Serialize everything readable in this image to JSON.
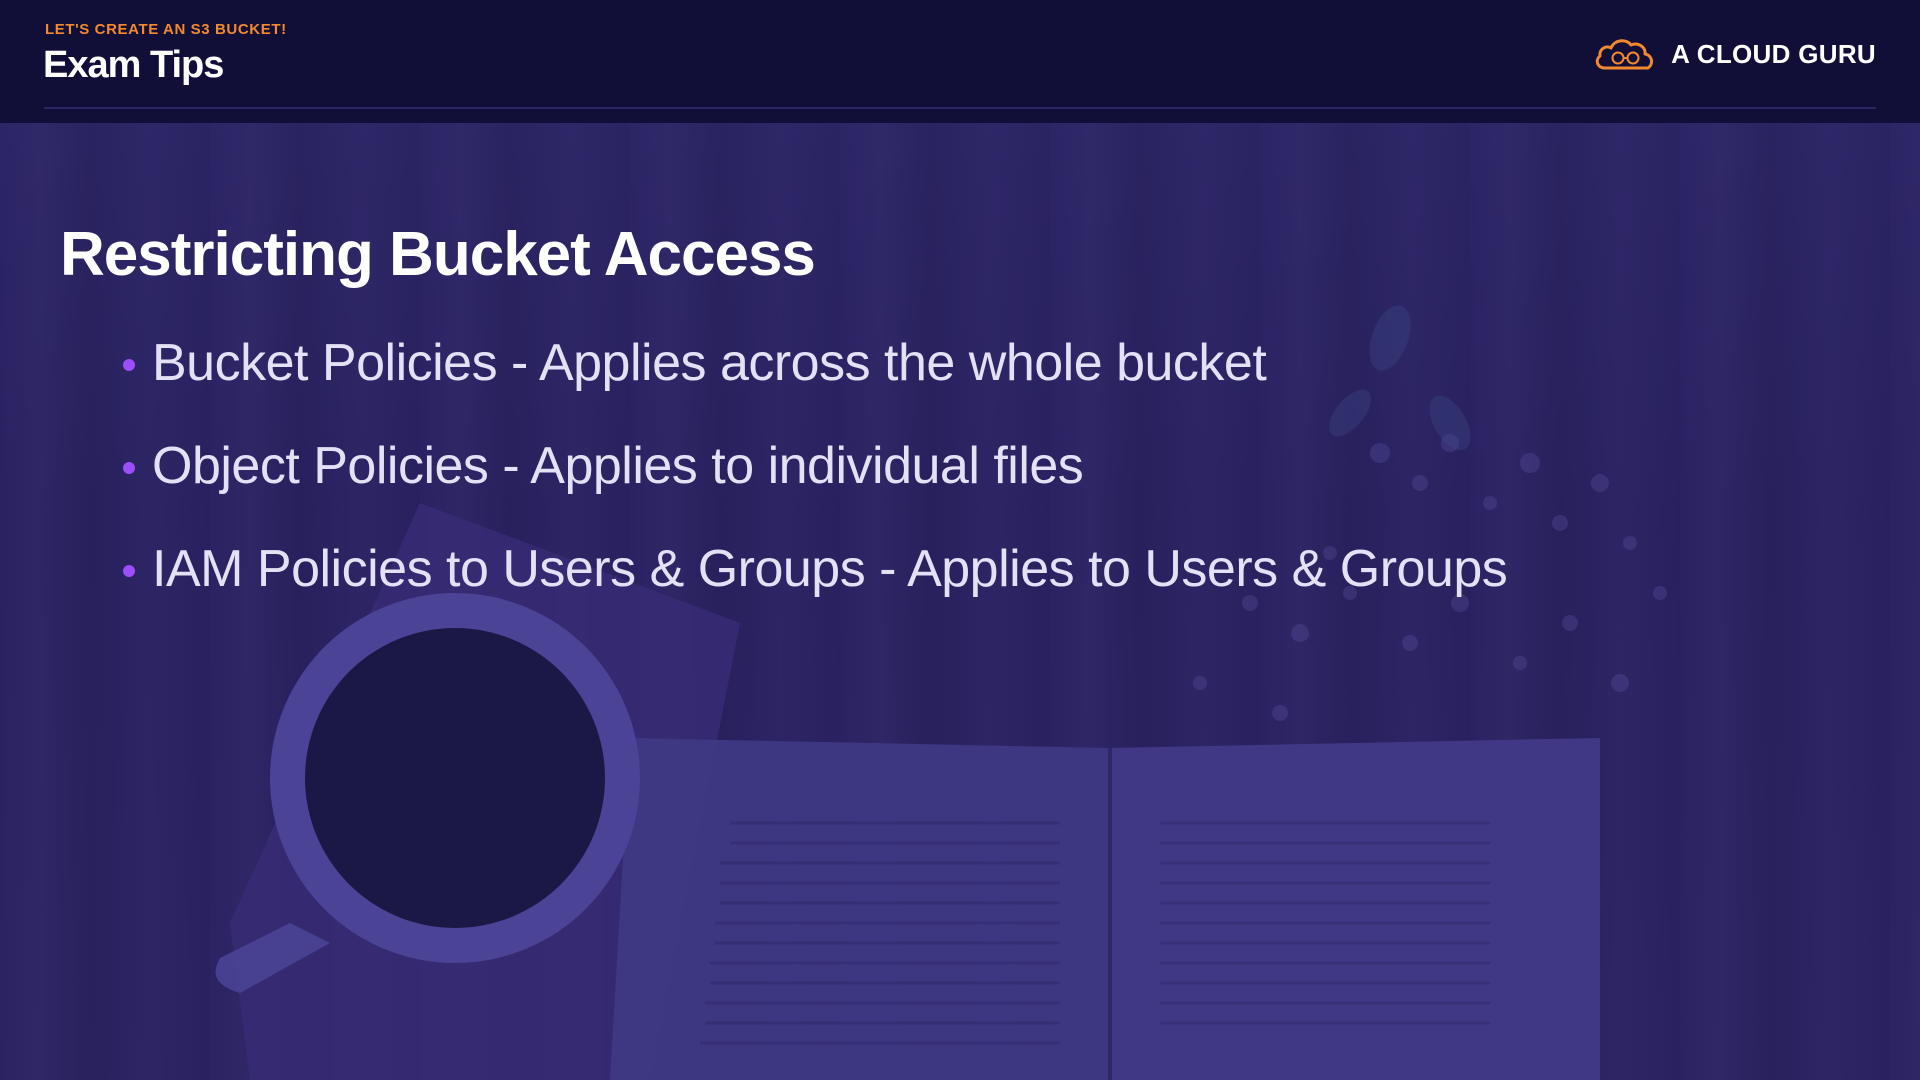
{
  "header": {
    "eyebrow": "LET'S CREATE AN S3 BUCKET!",
    "title": "Exam Tips",
    "brand_name": "A CLOUD GURU",
    "brand_icon": "cloud-logo-icon"
  },
  "slide": {
    "heading": "Restricting Bucket Access",
    "bullets": [
      {
        "text": "Bucket Policies - Applies across the whole bucket"
      },
      {
        "text": "Object Policies - Applies to individual files"
      },
      {
        "text": "IAM Policies to Users & Groups - Applies to Users & Groups"
      }
    ]
  },
  "colors": {
    "header_bg": "#110f38",
    "overlay": "#2b2363",
    "eyebrow": "#f2892e",
    "brand_logo": "#f2892e",
    "bullet_dot": "#9b4dff",
    "text": "#ffffff"
  }
}
